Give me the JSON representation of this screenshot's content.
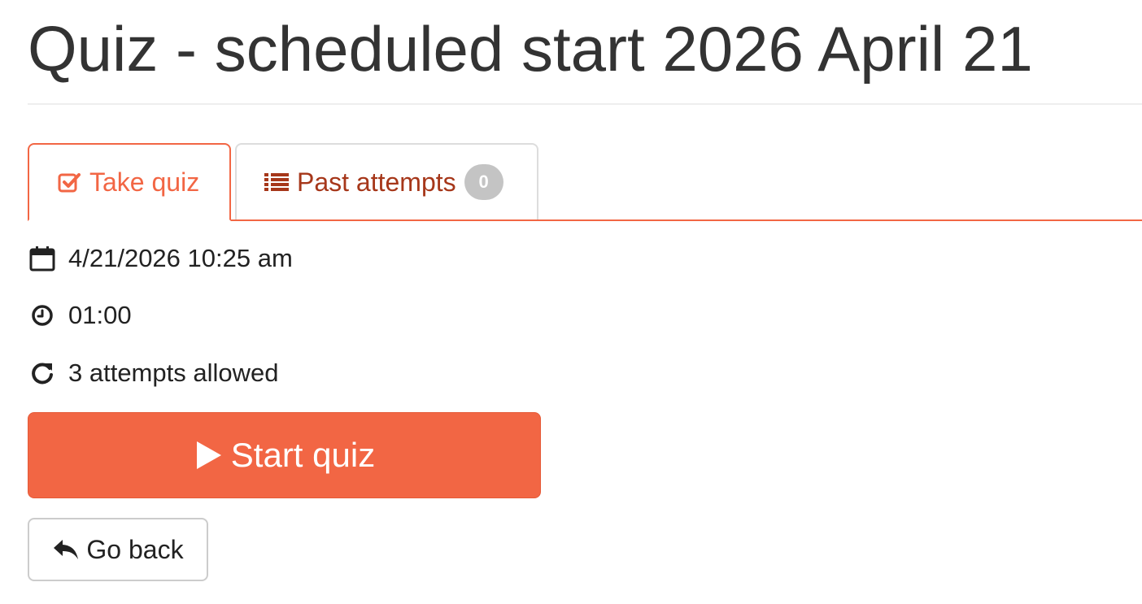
{
  "header": {
    "title": "Quiz - scheduled start 2026 April 21"
  },
  "tabs": [
    {
      "label": "Take quiz",
      "icon": "check-square-icon",
      "active": true
    },
    {
      "label": "Past attempts",
      "icon": "list-icon",
      "badge": "0",
      "active": false
    }
  ],
  "details": {
    "start_datetime": "4/21/2026 10:25 am",
    "start_icon": "calendar-icon",
    "duration": "01:00",
    "duration_icon": "clock-icon",
    "attempts": "3 attempts allowed",
    "attempts_icon": "refresh-icon"
  },
  "actions": {
    "start_label": "Start quiz",
    "start_icon": "play-icon",
    "back_label": "Go back",
    "back_icon": "reply-icon"
  },
  "colors": {
    "accent": "#f26644",
    "past_tab_text": "#a6371a",
    "badge_bg": "#c4c4c4",
    "text": "#333333"
  }
}
